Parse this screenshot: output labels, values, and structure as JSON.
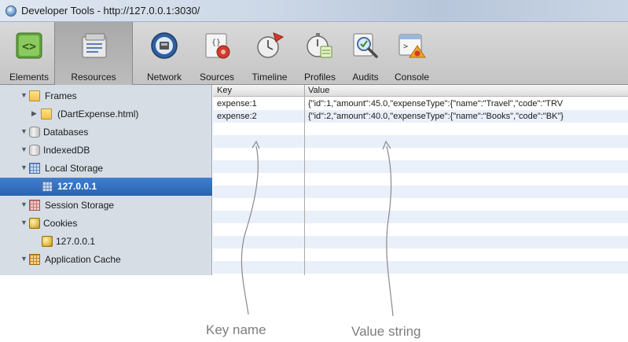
{
  "window": {
    "title": "Developer Tools - http://127.0.0.1:3030/"
  },
  "toolbar": {
    "tabs": [
      {
        "label": "Elements",
        "icon": "elements-icon"
      },
      {
        "label": "Resources",
        "icon": "resources-icon",
        "selected": true
      },
      {
        "label": "Network",
        "icon": "network-icon"
      },
      {
        "label": "Sources",
        "icon": "sources-icon"
      },
      {
        "label": "Timeline",
        "icon": "timeline-icon"
      },
      {
        "label": "Profiles",
        "icon": "profiles-icon"
      },
      {
        "label": "Audits",
        "icon": "audits-icon"
      },
      {
        "label": "Console",
        "icon": "console-icon"
      }
    ]
  },
  "sidebar": {
    "items": [
      {
        "label": "Frames",
        "icon": "folder-icon"
      },
      {
        "label": "(DartExpense.html)",
        "icon": "folder-icon"
      },
      {
        "label": "Databases",
        "icon": "database-icon"
      },
      {
        "label": "IndexedDB",
        "icon": "database-icon"
      },
      {
        "label": "Local Storage",
        "icon": "local-storage-icon"
      },
      {
        "label": "127.0.0.1",
        "icon": "local-storage-icon",
        "selected": true
      },
      {
        "label": "Session Storage",
        "icon": "session-storage-icon"
      },
      {
        "label": "Cookies",
        "icon": "cookies-icon"
      },
      {
        "label": "127.0.0.1",
        "icon": "cookies-icon"
      },
      {
        "label": "Application Cache",
        "icon": "application-cache-icon"
      }
    ]
  },
  "grid": {
    "columns": [
      "Key",
      "Value"
    ],
    "rows": [
      {
        "key": "expense:1",
        "value": "{\"id\":1,\"amount\":45.0,\"expenseType\":{\"name\":\"Travel\",\"code\":\"TRV"
      },
      {
        "key": "expense:2",
        "value": "{\"id\":2,\"amount\":40.0,\"expenseType\":{\"name\":\"Books\",\"code\":\"BK\"}"
      }
    ]
  },
  "annotations": {
    "key_label": "Key name",
    "value_label": "Value string"
  },
  "colors": {
    "selection": "#2a63ad",
    "sidebar_bg": "#d6dde5",
    "row_alt": "#eaf0f9",
    "callout": "#7d7d7d"
  }
}
